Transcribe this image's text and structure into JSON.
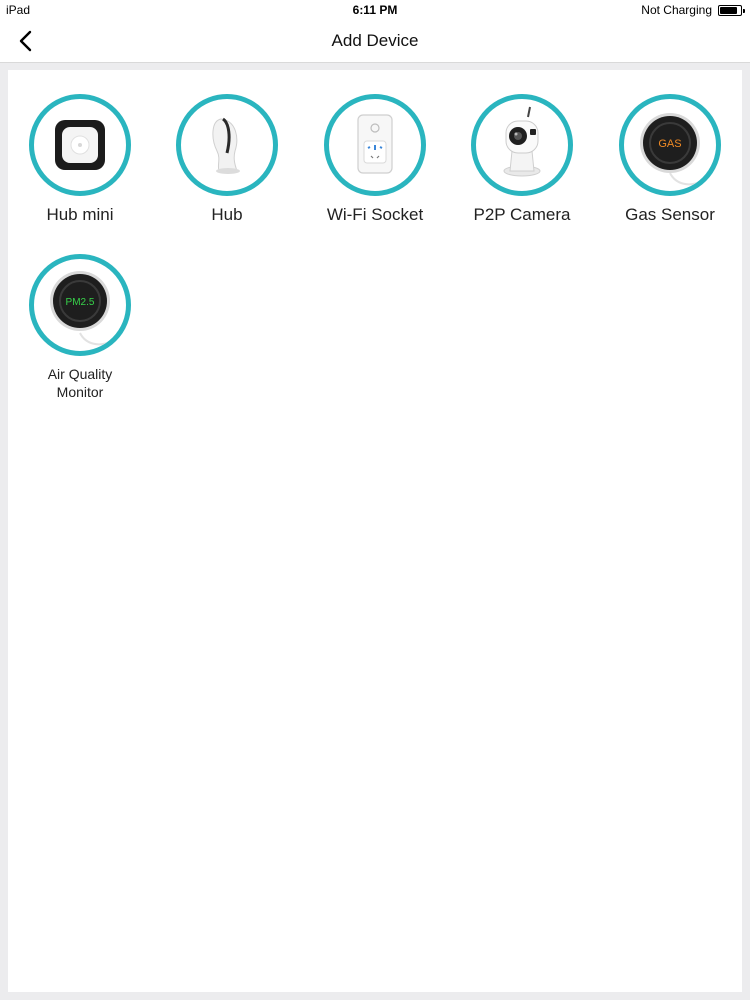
{
  "status_bar": {
    "device": "iPad",
    "time": "6:11 PM",
    "charging": "Not Charging",
    "battery_level": 0.85
  },
  "navbar": {
    "back_icon": "chevron-left-icon",
    "title": "Add Device"
  },
  "devices": [
    {
      "label": "Hub mini",
      "icon": "hub-mini-icon"
    },
    {
      "label": "Hub",
      "icon": "hub-icon"
    },
    {
      "label": "Wi-Fi Socket",
      "icon": "wifi-socket-icon"
    },
    {
      "label": "P2P Camera",
      "icon": "p2p-camera-icon"
    },
    {
      "label": "Gas Sensor",
      "icon": "gas-sensor-icon",
      "badge_text": "GAS"
    },
    {
      "label": "Air Quality Monitor",
      "icon": "air-quality-monitor-icon",
      "badge_text": "PM2.5"
    }
  ],
  "colors": {
    "ring": "#2ab5bf",
    "gas_text": "#f08a24",
    "pm_text": "#37d24a"
  }
}
